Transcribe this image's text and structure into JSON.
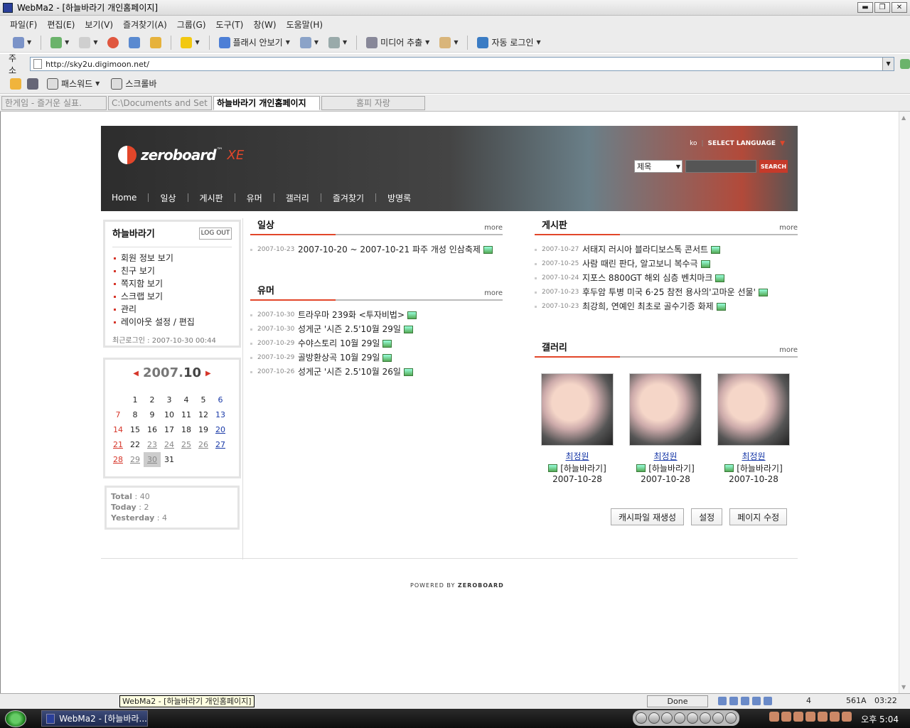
{
  "window": {
    "title": "WebMa2 - [하늘바라기 개인홈페이지]",
    "minimize": "▬",
    "restore": "❐",
    "close": "✕"
  },
  "menu": [
    "파일(F)",
    "편집(E)",
    "보기(V)",
    "즐겨찾기(A)",
    "그룹(G)",
    "도구(T)",
    "창(W)",
    "도움말(H)"
  ],
  "toolbar": {
    "flash_block": "플래시 안보기",
    "media_extract": "미디어 추출",
    "auto_login": "자동 로그인"
  },
  "address": {
    "label": "주소",
    "url": "http://sky2u.digimoon.net/"
  },
  "linkbar": {
    "password": "패스워드",
    "scrollbar": "스크롤바"
  },
  "tabs": [
    {
      "label": "한게임 - 즐거운 실표."
    },
    {
      "label": "C:\\Documents and Set"
    },
    {
      "label": "하늘바라기 개인홈페이지",
      "active": true
    },
    {
      "label": "홈피 자랑"
    }
  ],
  "header": {
    "logo_text": "zeroboard",
    "logo_tm": "™",
    "logo_xe": "XE",
    "lang_code": "ko",
    "lang_sep": "|",
    "select_language": "SELECT LANGUAGE",
    "search_option": "제목",
    "search_button": "SEARCH"
  },
  "nav": [
    "Home",
    "일상",
    "게시판",
    "유머",
    "갤러리",
    "즐겨찾기",
    "방명록"
  ],
  "login": {
    "username": "하늘바라기",
    "logout": "LOG OUT",
    "links": [
      "회원 정보 보기",
      "친구 보기",
      "쪽지함 보기",
      "스크랩 보기",
      "관리",
      "레이아웃 설정 / 편집"
    ],
    "last_login": "최근로그인 : 2007-10-30 00:44"
  },
  "calendar": {
    "year": "2007.",
    "month": "10",
    "days": [
      {
        "d": ""
      },
      {
        "d": "1"
      },
      {
        "d": "2"
      },
      {
        "d": "3"
      },
      {
        "d": "4"
      },
      {
        "d": "5"
      },
      {
        "d": "6",
        "t": "sat"
      },
      {
        "d": "7",
        "t": "sun"
      },
      {
        "d": "8"
      },
      {
        "d": "9"
      },
      {
        "d": "10"
      },
      {
        "d": "11"
      },
      {
        "d": "12"
      },
      {
        "d": "13",
        "t": "sat"
      },
      {
        "d": "14",
        "t": "sun"
      },
      {
        "d": "15"
      },
      {
        "d": "16"
      },
      {
        "d": "17"
      },
      {
        "d": "18"
      },
      {
        "d": "19"
      },
      {
        "d": "20",
        "t": "sat",
        "u": true
      },
      {
        "d": "21",
        "t": "sun",
        "u": true
      },
      {
        "d": "22"
      },
      {
        "d": "23",
        "t": "gray",
        "u": true
      },
      {
        "d": "24",
        "t": "gray",
        "u": true
      },
      {
        "d": "25",
        "t": "gray",
        "u": true
      },
      {
        "d": "26",
        "t": "gray",
        "u": true
      },
      {
        "d": "27",
        "t": "sat",
        "u": true
      },
      {
        "d": "28",
        "t": "sun",
        "u": true
      },
      {
        "d": "29",
        "t": "gray",
        "u": true
      },
      {
        "d": "30",
        "t": "today",
        "u": true
      },
      {
        "d": "31"
      },
      {
        "d": ""
      },
      {
        "d": ""
      },
      {
        "d": ""
      }
    ]
  },
  "counter": {
    "total_label": "Total",
    "total": "40",
    "today_label": "Today",
    "today": "2",
    "yesterday_label": "Yesterday",
    "yesterday": "4"
  },
  "sections": {
    "daily": {
      "title": "일상",
      "more": "more",
      "items": [
        {
          "date": "2007-10-23",
          "title": "2007-10-20 ~ 2007-10-21 파주 개성 인삼축제"
        }
      ]
    },
    "humor": {
      "title": "유머",
      "more": "more",
      "items": [
        {
          "date": "2007-10-30",
          "title": "트라우마 239화 <투자비법>"
        },
        {
          "date": "2007-10-30",
          "title": "성게군 '시즌 2.5'10월 29일"
        },
        {
          "date": "2007-10-29",
          "title": "수야스토리 10월 29일"
        },
        {
          "date": "2007-10-29",
          "title": "골방환상곡 10월 29일"
        },
        {
          "date": "2007-10-26",
          "title": "성게군 '시즌 2.5'10월 26일"
        }
      ]
    },
    "board": {
      "title": "게시판",
      "more": "more",
      "items": [
        {
          "date": "2007-10-27",
          "title": "서태지 러시아 블라디보스톡 콘서트"
        },
        {
          "date": "2007-10-25",
          "title": "사람 때린 판다, 알고보니 복수극"
        },
        {
          "date": "2007-10-24",
          "title": "지포스 8800GT 해외 심층 벤치마크"
        },
        {
          "date": "2007-10-23",
          "title": "후두암 투병 미국 6·25 참전 용사의'고마운 선물'"
        },
        {
          "date": "2007-10-23",
          "title": "최강희, 연예인 최초로 골수기증 화제"
        }
      ]
    },
    "gallery": {
      "title": "갤러리",
      "more": "more",
      "items": [
        {
          "name": "최정원",
          "category": "[하늘바라기]",
          "date": "2007-10-28"
        },
        {
          "name": "최정원",
          "category": "[하늘바라기]",
          "date": "2007-10-28"
        },
        {
          "name": "최정원",
          "category": "[하늘바라기]",
          "date": "2007-10-28"
        }
      ]
    }
  },
  "buttons": {
    "cache": "캐시파일 재생성",
    "settings": "설정",
    "edit_page": "페이지 수정"
  },
  "powered": {
    "prefix": "POWERED BY",
    "brand": "ZEROBOARD"
  },
  "status": {
    "tooltip": "WebMa2 - [하늘바라기 개인홈페이지]",
    "done": "Done",
    "count": "4",
    "mem": "561A",
    "time": "03:22"
  },
  "taskbar": {
    "item": "WebMa2 - [하늘바라...",
    "clock": "오후 5:04"
  }
}
